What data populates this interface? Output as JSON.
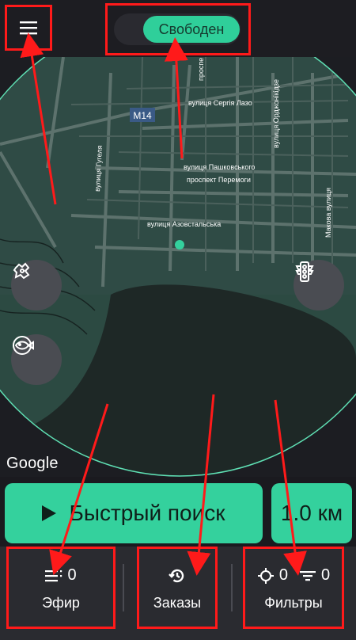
{
  "header": {
    "menu_icon": "hamburger-icon",
    "status_label": "Свободен"
  },
  "map": {
    "labels": {
      "m14": "M14",
      "street_lazo": "вулиця Сергія Лазо",
      "street_pashk": "вулиця Пашковського",
      "prospekt": "проспект Перемоги",
      "street_azov": "вулиця Азовстальська",
      "street_gugel": "вулиця Гугеля",
      "street_ordzh": "вулиця Орджонікідзе",
      "street_mak": "Макова вулиця",
      "street_prosp": "проспе",
      "google": "Google"
    },
    "buttons": {
      "left_top_icon": "puzzle-location-icon",
      "left_bottom_icon": "fish-icon",
      "right_icon": "traffic-light-icon"
    }
  },
  "controls": {
    "quick_search_label": "Быстрый поиск",
    "radius_label": "1.0 км"
  },
  "tabs": {
    "air": {
      "count": "0",
      "label": "Эфир",
      "icon": "list-icon"
    },
    "orders": {
      "label": "Заказы",
      "icon": "history-icon"
    },
    "filters": {
      "label": "Фильтры",
      "loc_count": "0",
      "filter_count": "0",
      "icon1": "crosshair-icon",
      "icon2": "filter-icon"
    }
  },
  "colors": {
    "accent": "#34d19d",
    "annotation": "#ff1a1a",
    "bar": "#2a2b30"
  }
}
